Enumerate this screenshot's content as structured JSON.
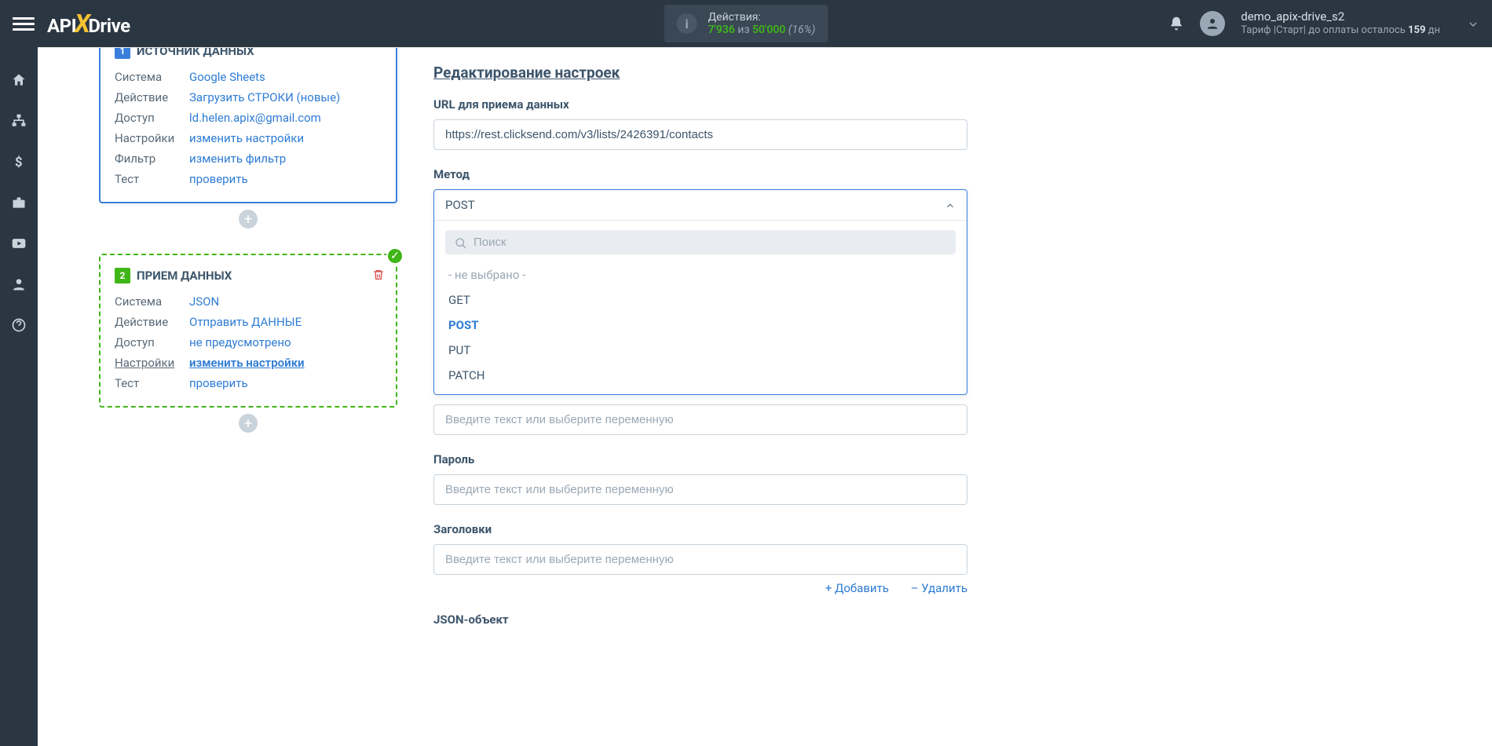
{
  "header": {
    "logo_pre": "API",
    "logo_x": "X",
    "logo_post": "Drive",
    "actions_label": "Действия:",
    "actions_current": "7'936",
    "actions_of": " из ",
    "actions_total": "50'000",
    "actions_pct": " (16%)",
    "user_name": "demo_apix-drive_s2",
    "user_plan_pre": "Тариф |Старт| до оплаты осталось ",
    "user_plan_days": "159",
    "user_plan_suf": " дн"
  },
  "source": {
    "title": "ИСТОЧНИК ДАННЫХ",
    "badge": "1",
    "rows": {
      "system_l": "Система",
      "system_v": "Google Sheets",
      "action_l": "Действие",
      "action_v": "Загрузить СТРОКИ (новые)",
      "access_l": "Доступ",
      "access_v": "ld.helen.apix@gmail.com",
      "settings_l": "Настройки",
      "settings_v": "изменить настройки",
      "filter_l": "Фильтр",
      "filter_v": "изменить фильтр",
      "test_l": "Тест",
      "test_v": "проверить"
    }
  },
  "dest": {
    "title": "ПРИЕМ ДАННЫХ",
    "badge": "2",
    "rows": {
      "system_l": "Система",
      "system_v": "JSON",
      "action_l": "Действие",
      "action_v": "Отправить ДАННЫЕ",
      "access_l": "Доступ",
      "access_v": "не предусмотрено",
      "settings_l": "Настройки",
      "settings_v": "изменить настройки",
      "test_l": "Тест",
      "test_v": "проверить"
    }
  },
  "form": {
    "section_title": "Редактирование настроек",
    "url_label": "URL для приема данных",
    "url_value": "https://rest.clicksend.com/v3/lists/2426391/contacts",
    "method_label": "Метод",
    "method_selected": "POST",
    "search_placeholder": "Поиск",
    "opts": [
      "- не выбрано -",
      "GET",
      "POST",
      "PUT",
      "PATCH"
    ],
    "var_placeholder": "Введите текст или выберите переменную",
    "password_label": "Пароль",
    "headers_label": "Заголовки",
    "add": "Добавить",
    "del": "Удалить",
    "json_label": "JSON-объект"
  }
}
